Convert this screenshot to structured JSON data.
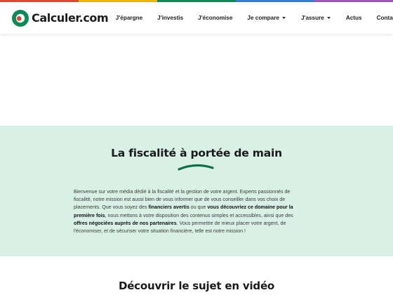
{
  "brand": {
    "name": "Calculer.com",
    "colors": {
      "green": "#0f8a55",
      "red": "#e2463a",
      "mint_bg": "#d9f0e6"
    },
    "topbar_colors": [
      "#e2463a",
      "#f4b400",
      "#0f8a55",
      "#3a7bd5",
      "#9b59b6"
    ]
  },
  "nav": {
    "items": [
      {
        "label": "J'épargne",
        "dropdown": false
      },
      {
        "label": "J'investis",
        "dropdown": false
      },
      {
        "label": "J'économise",
        "dropdown": false
      },
      {
        "label": "Je compare",
        "dropdown": true
      },
      {
        "label": "J'assure",
        "dropdown": true
      },
      {
        "label": "Actus",
        "dropdown": false
      },
      {
        "label": "Contact",
        "dropdown": false
      }
    ]
  },
  "intro": {
    "title": "La fiscalité à portée de main",
    "text_1": "Bienvenue sur votre média dédié à la fiscalité et la gestion de votre argent. Experts passionnés de fiscalité, notre mission est aussi bien de vous informer que de vous conseiller dans vos choix de placements. Que vous soyez des ",
    "bold_1": "financiers avertis",
    "text_2": " ou que ",
    "bold_2": "vous découvriez ce domaine pour la première fois",
    "text_3": ", nous mettons à votre disposition des contenus simples et accessibles, ainsi que des ",
    "bold_3": "offres négociées auprès de nos partenaires",
    "text_4": ". Vous permettre de mieux placer votre argent, de l'économiser,  et de sécuriser votre situation financière, telle est notre mission !"
  },
  "video": {
    "title": "Découvrir le sujet en vidéo"
  }
}
